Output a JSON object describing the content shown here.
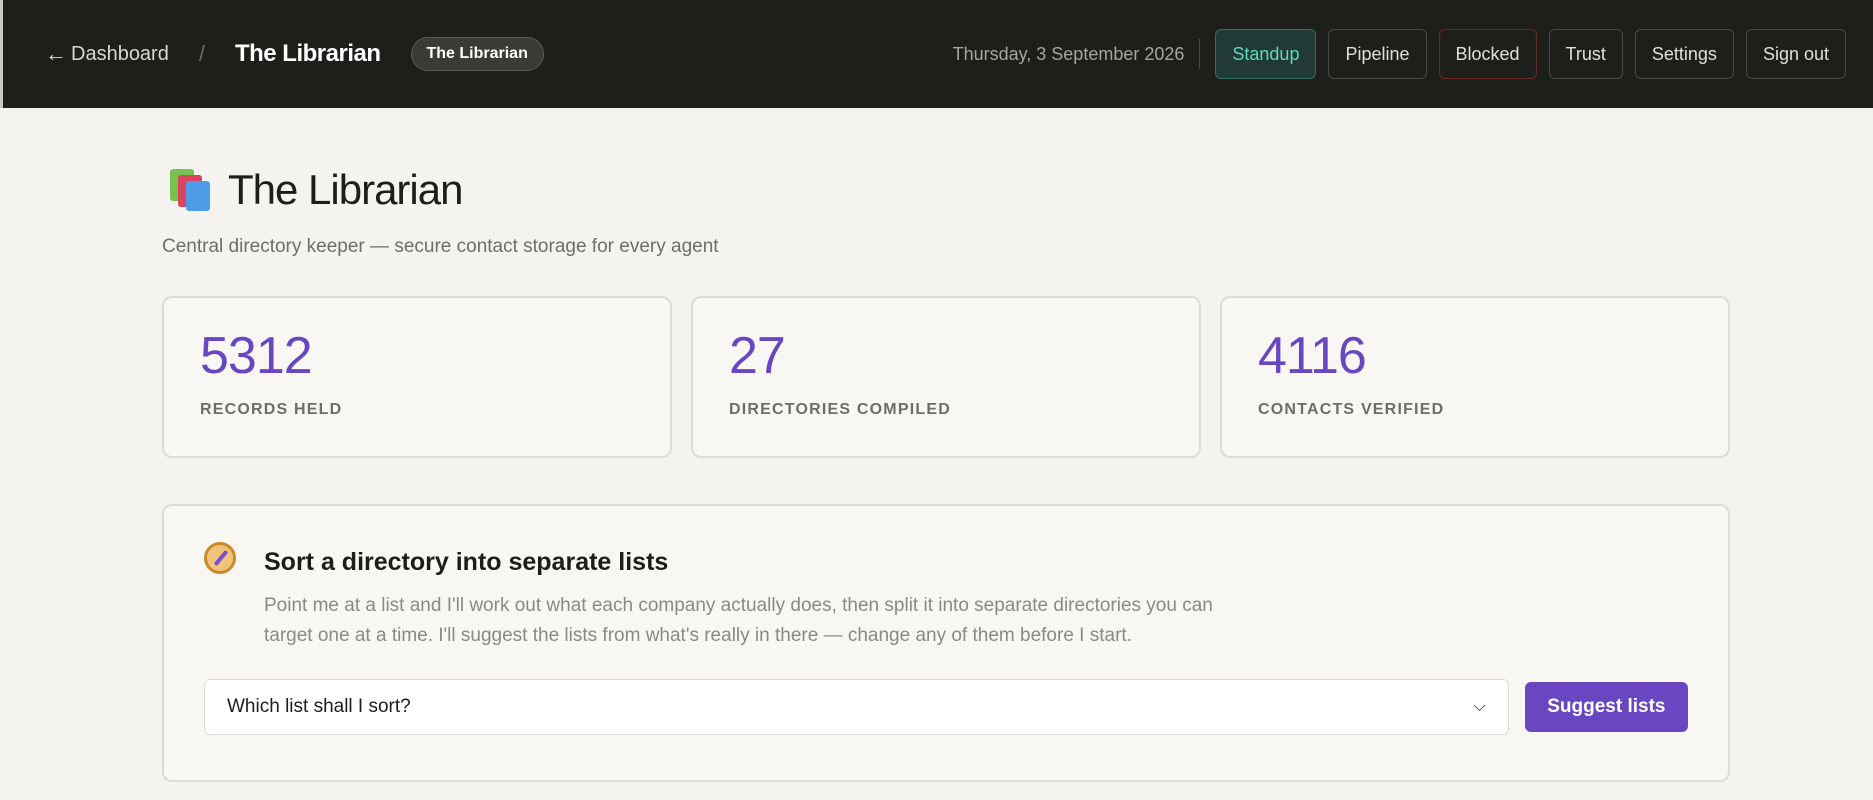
{
  "header": {
    "back_label": "Dashboard",
    "back_arrow": "←",
    "separator": "/",
    "crumb_title": "The Librarian",
    "crumb_badge": "The Librarian",
    "date": "Thursday, 3 September 2026",
    "nav": [
      {
        "label": "Standup",
        "state": "active"
      },
      {
        "label": "Pipeline"
      },
      {
        "label": "Blocked",
        "state": "danger"
      },
      {
        "label": "Trust"
      },
      {
        "label": "Settings"
      },
      {
        "label": "Sign out"
      }
    ]
  },
  "page": {
    "icon": "books-icon",
    "title": "The Librarian",
    "subtitle": "Central directory keeper — secure contact storage for every agent"
  },
  "stats": [
    {
      "value": "5312",
      "label": "RECORDS HELD"
    },
    {
      "value": "27",
      "label": "DIRECTORIES COMPILED"
    },
    {
      "value": "4116",
      "label": "CONTACTS VERIFIED"
    }
  ],
  "sort": {
    "icon": "compass-icon",
    "title": "Sort a directory into separate lists",
    "description": "Point me at a list and I'll work out what each company actually does, then split it into separate directories you can target one at a time. I'll suggest the lists from what's really in there — change any of them before I start.",
    "select_placeholder": "Which list shall I sort?",
    "button_label": "Suggest lists"
  },
  "colors": {
    "accent": "#6a47c2",
    "header_bg": "#1e1e1a",
    "active_nav": "#5fd9bd",
    "page_bg": "#f4f3ef"
  }
}
